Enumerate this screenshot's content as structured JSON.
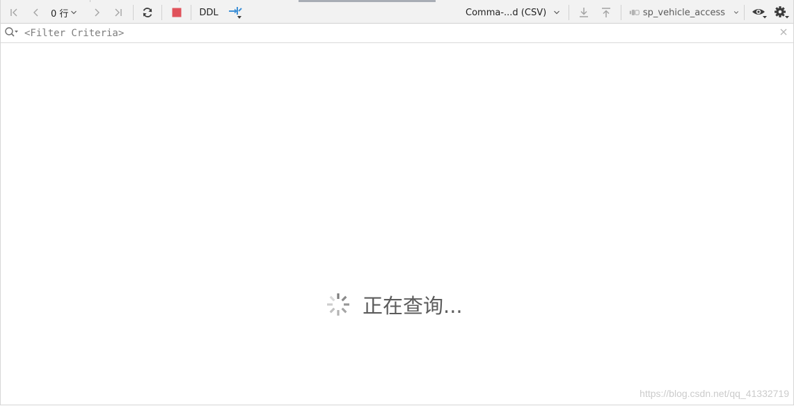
{
  "toolbar": {
    "row_count": "0 行",
    "ddl_label": "DDL",
    "export_format": "Comma-...d (CSV)",
    "datasource": "sp_vehicle_access"
  },
  "filter": {
    "placeholder": "<Filter Criteria>",
    "value": ""
  },
  "status": {
    "loading_text": "正在查询..."
  },
  "watermark": "https://blog.csdn.net/qq_41332719",
  "colors": {
    "toolbar_bg": "#f2f2f2",
    "stop_red": "#e0525b",
    "accent_blue": "#3d8fd6",
    "icon_gray": "#8c8c8c",
    "icon_dark": "#3c3c3c"
  }
}
